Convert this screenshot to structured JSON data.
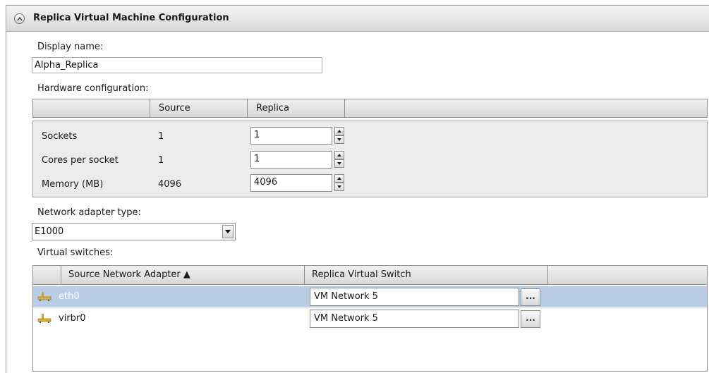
{
  "section": {
    "title": "Replica Virtual Machine Configuration",
    "collapse_icon": "chevron-up-icon"
  },
  "display_name": {
    "label": "Display name:",
    "value": "Alpha_Replica"
  },
  "hardware": {
    "label": "Hardware configuration:",
    "columns": [
      "",
      "Source",
      "Replica"
    ],
    "rows": [
      {
        "name": "Sockets",
        "source": "1",
        "replica": "1"
      },
      {
        "name": "Cores per socket",
        "source": "1",
        "replica": "1"
      },
      {
        "name": "Memory (MB)",
        "source": "4096",
        "replica": "4096"
      }
    ]
  },
  "network_adapter": {
    "label": "Network adapter type:",
    "value": "E1000"
  },
  "virtual_switches": {
    "label": "Virtual switches:",
    "columns": [
      "",
      "Source Network Adapter ▲",
      "Replica Virtual Switch"
    ],
    "rows": [
      {
        "adapter": "eth0",
        "switch": "VM Network 5",
        "selected": true,
        "browse": "..."
      },
      {
        "adapter": "virbr0",
        "switch": "VM Network 5",
        "selected": false,
        "browse": "..."
      }
    ]
  },
  "colors": {
    "selected_row": "#b9cee6",
    "panel_bg": "#ececec"
  }
}
